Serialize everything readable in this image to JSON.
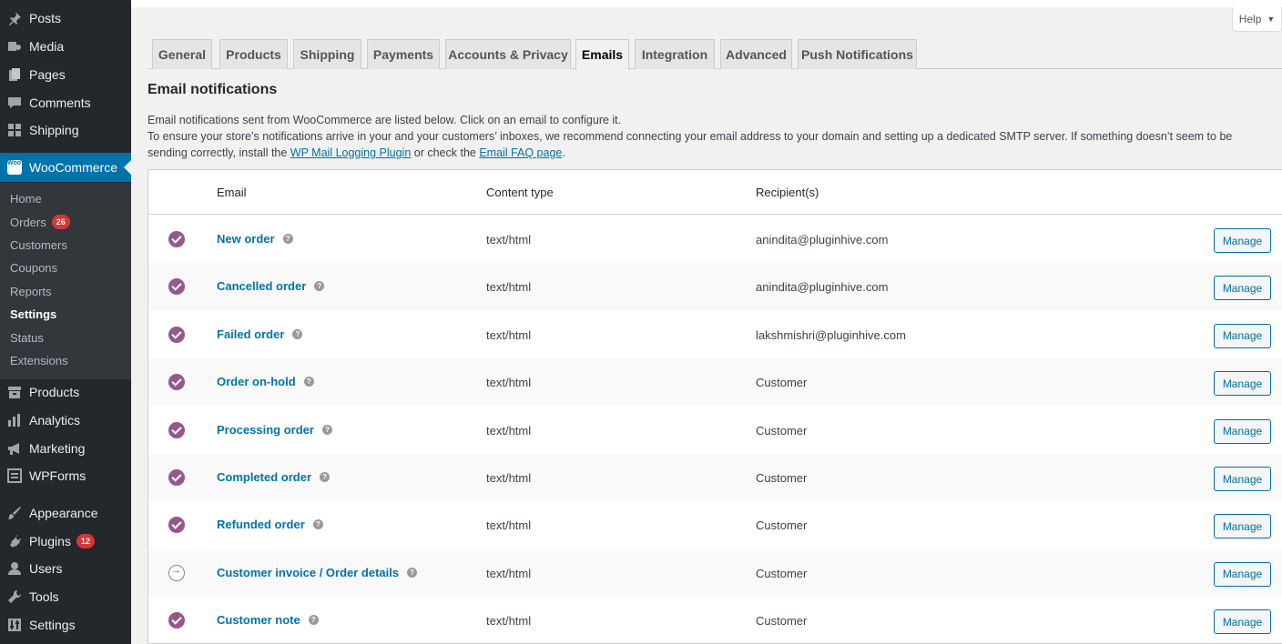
{
  "sidebar": {
    "items": [
      {
        "label": "Posts",
        "icon": "pin-icon"
      },
      {
        "label": "Media",
        "icon": "media-icon"
      },
      {
        "label": "Pages",
        "icon": "pages-icon"
      },
      {
        "label": "Comments",
        "icon": "comments-icon"
      },
      {
        "label": "Shipping",
        "icon": "grid-icon"
      },
      {
        "label": "WooCommerce",
        "icon": "woo-icon",
        "logo_text": "Woo"
      },
      {
        "label": "Products",
        "icon": "archive-icon"
      },
      {
        "label": "Analytics",
        "icon": "bar-chart-icon"
      },
      {
        "label": "Marketing",
        "icon": "megaphone-icon"
      },
      {
        "label": "WPForms",
        "icon": "forms-icon"
      },
      {
        "label": "Appearance",
        "icon": "brush-icon"
      },
      {
        "label": "Plugins",
        "icon": "plug-icon",
        "badge": "12"
      },
      {
        "label": "Users",
        "icon": "user-icon"
      },
      {
        "label": "Tools",
        "icon": "wrench-icon"
      },
      {
        "label": "Settings",
        "icon": "settings-icon"
      }
    ],
    "submenu": [
      {
        "label": "Home"
      },
      {
        "label": "Orders",
        "badge": "26"
      },
      {
        "label": "Customers"
      },
      {
        "label": "Coupons"
      },
      {
        "label": "Reports"
      },
      {
        "label": "Settings"
      },
      {
        "label": "Status"
      },
      {
        "label": "Extensions"
      }
    ]
  },
  "help": {
    "label": "Help",
    "caret": "▼"
  },
  "tabs": [
    "General",
    "Products",
    "Shipping",
    "Payments",
    "Accounts & Privacy",
    "Emails",
    "Integration",
    "Advanced",
    "Push Notifications"
  ],
  "section_title": "Email notifications",
  "description": {
    "line1": "Email notifications sent from WooCommerce are listed below. Click on an email to configure it.",
    "line2_pre": "To ensure your store’s notifications arrive in your and your customers’ inboxes, we recommend connecting your email address to your domain and setting up a dedicated SMTP server. If something doesn’t seem to be sending correctly, install the ",
    "link1": "WP Mail Logging Plugin",
    "line2_mid": " or check the ",
    "link2": "Email FAQ page",
    "line2_end": "."
  },
  "table": {
    "headers": {
      "email": "Email",
      "content_type": "Content type",
      "recipients": "Recipient(s)"
    },
    "help_glyph": "?",
    "manage_label": "Manage",
    "rows": [
      {
        "name": "New order",
        "content_type": "text/html",
        "recipient": "anindita@pluginhive.com",
        "status": "enabled"
      },
      {
        "name": "Cancelled order",
        "content_type": "text/html",
        "recipient": "anindita@pluginhive.com",
        "status": "enabled"
      },
      {
        "name": "Failed order",
        "content_type": "text/html",
        "recipient": "lakshmishri@pluginhive.com",
        "status": "enabled"
      },
      {
        "name": "Order on-hold",
        "content_type": "text/html",
        "recipient": "Customer",
        "status": "enabled"
      },
      {
        "name": "Processing order",
        "content_type": "text/html",
        "recipient": "Customer",
        "status": "enabled"
      },
      {
        "name": "Completed order",
        "content_type": "text/html",
        "recipient": "Customer",
        "status": "enabled"
      },
      {
        "name": "Refunded order",
        "content_type": "text/html",
        "recipient": "Customer",
        "status": "enabled"
      },
      {
        "name": "Customer invoice / Order details",
        "content_type": "text/html",
        "recipient": "Customer",
        "status": "manual"
      },
      {
        "name": "Customer note",
        "content_type": "text/html",
        "recipient": "Customer",
        "status": "enabled"
      }
    ]
  },
  "colors": {
    "accent": "#0073aa",
    "woo_purple": "#96588a",
    "sidebar_bg": "#23282d",
    "badge": "#d63638"
  }
}
